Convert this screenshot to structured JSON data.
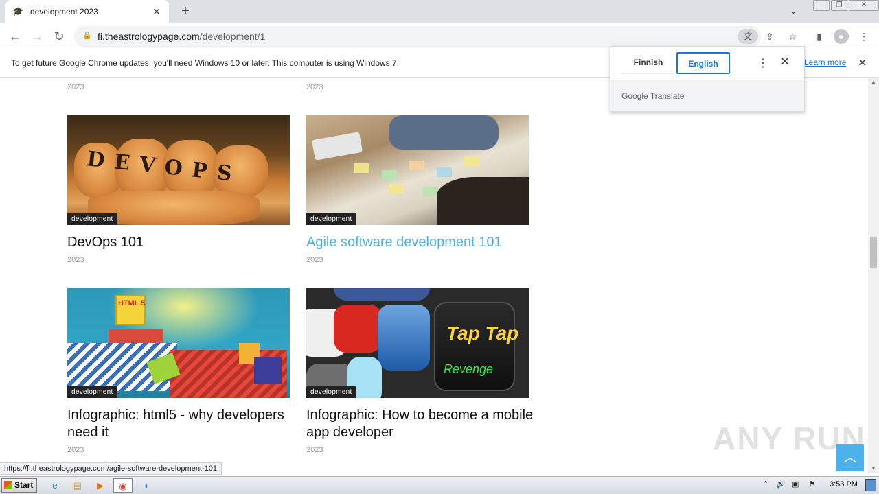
{
  "browser": {
    "tab_title": "development 2023",
    "tab_close": "✕",
    "new_tab": "+",
    "url_host": "fi.theastrologypage.com",
    "url_path": "/development/1"
  },
  "infobar": {
    "message": "To get future Google Chrome updates, you'll need Windows 10 or later. This computer is using Windows 7.",
    "learn_more": "Learn more"
  },
  "translate": {
    "source_lang": "Finnish",
    "target_lang": "English",
    "footer": "Google Translate"
  },
  "articles": [
    {
      "category": "development",
      "title": "DevOps 101",
      "year": "2023"
    },
    {
      "category": "development",
      "title": "Agile software development 101",
      "year": "2023"
    },
    {
      "category": "development",
      "title": "Infographic: html5 - why developers need it",
      "year": "2023"
    },
    {
      "category": "development",
      "title": "Infographic: How to become a mobile app developer",
      "year": "2023"
    }
  ],
  "prev_row_years": [
    "2023",
    "2023"
  ],
  "status_bar_url": "https://fi.theastrologypage.com/agile-software-development-101",
  "image_text": {
    "devops": "DEVOPS",
    "html5_badge": "HTML 5",
    "tap_tap": "Tap Tap",
    "revenge": "Revenge"
  },
  "watermark": "ANY RUN",
  "taskbar": {
    "start_label": "Start",
    "clock": "3:53 PM"
  },
  "colors": {
    "accent": "#4db2ec",
    "link": "#1a73e8"
  }
}
